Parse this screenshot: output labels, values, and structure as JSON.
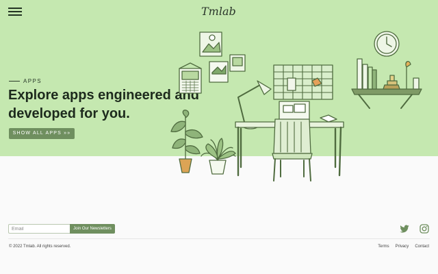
{
  "header": {
    "logo_text": "Tmlab",
    "menu_icon": "hamburger-menu-icon"
  },
  "hero": {
    "eyebrow": "APPS",
    "headline": "Explore apps engineered and developed for you.",
    "cta_label": "SHOW ALL APPS »»"
  },
  "colors": {
    "hero_bg": "#c5e8b0",
    "accent": "#6f8f5f",
    "text": "#1d2a1d"
  },
  "footer": {
    "email_placeholder": "Email",
    "subscribe_label": "Join Our Newsletters",
    "social": [
      "twitter-icon",
      "instagram-icon"
    ],
    "copyright": "© 2022 Tmlab. All rights reserved.",
    "links": [
      "Terms",
      "Privacy",
      "Contact"
    ]
  }
}
